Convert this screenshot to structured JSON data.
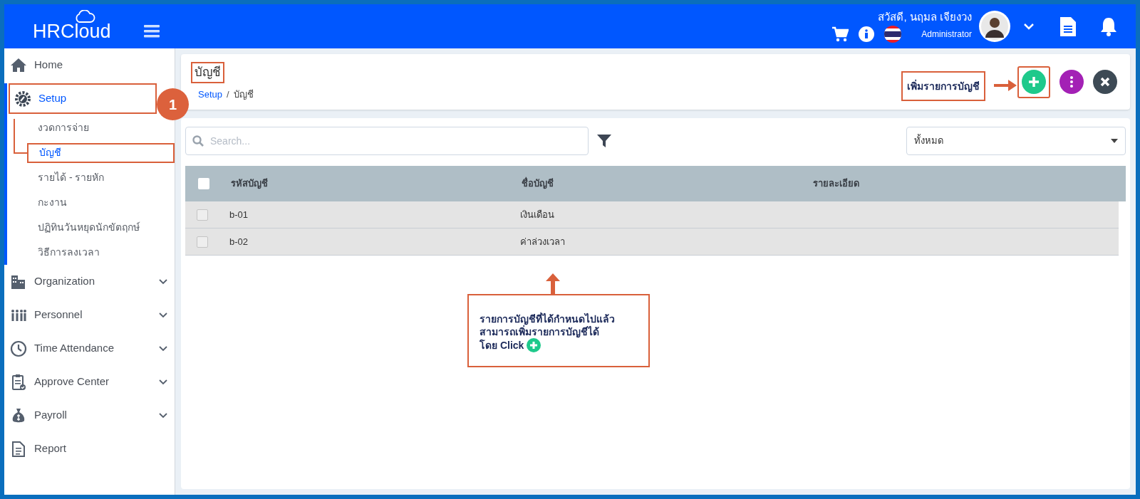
{
  "header": {
    "logo": "HRCloud",
    "greeting": "สวัสดี, นฤมล เจียงวง",
    "role": "Administrator"
  },
  "sidebar": {
    "items": [
      {
        "label": "Home",
        "selected": false
      },
      {
        "label": "Setup",
        "selected": true,
        "expanded": true,
        "highlighted": true,
        "children": [
          {
            "label": "งวดการจ่าย",
            "selected": false
          },
          {
            "label": "บัญชี",
            "selected": true,
            "highlighted": true
          },
          {
            "label": "รายได้ - รายหัก",
            "selected": false
          },
          {
            "label": "กะงาน",
            "selected": false
          },
          {
            "label": "ปฏิทินวันหยุดนักขัตฤกษ์",
            "selected": false
          },
          {
            "label": "วิธีการลงเวลา",
            "selected": false
          }
        ]
      },
      {
        "label": "Organization",
        "selected": false,
        "expanded": false
      },
      {
        "label": "Personnel",
        "selected": false,
        "expanded": false
      },
      {
        "label": "Time Attendance",
        "selected": false,
        "expanded": false
      },
      {
        "label": "Approve Center",
        "selected": false,
        "expanded": false
      },
      {
        "label": "Payroll",
        "selected": false,
        "expanded": false
      },
      {
        "label": "Report",
        "selected": false
      }
    ]
  },
  "page": {
    "title": "บัญชี",
    "title_highlighted": true,
    "breadcrumb": [
      "Setup",
      "บัญชี"
    ],
    "breadcrumb_separator": "/",
    "add_button_highlighted": true
  },
  "toolbar": {
    "search": {
      "placeholder": "Search..."
    },
    "filter_select": "ทั้งหมด"
  },
  "table": {
    "columns": [
      "รหัสบัญชี",
      "ชื่อบัญชี",
      "รายละเอียด"
    ],
    "header_checked": false,
    "rows": [
      {
        "checked": false,
        "cells": [
          "b-01",
          "เงินเดือน",
          ""
        ]
      },
      {
        "checked": false,
        "cells": [
          "b-02",
          "ค่าล่วงเวลา",
          ""
        ]
      }
    ]
  },
  "annotations": {
    "step_badge": "1",
    "add_label": "เพิ่มรายการบัญชี",
    "callout": [
      "รายการบัญชีที่ได้กำหนดไปแล้ว",
      "สามารถเพิ่มรายการบัญชีได้",
      "โดย Click"
    ]
  }
}
